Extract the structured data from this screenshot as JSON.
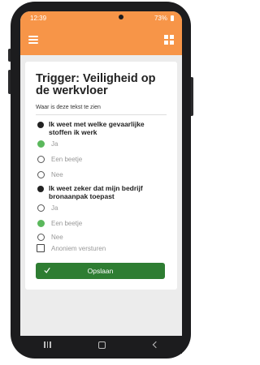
{
  "status": {
    "time": "12:39",
    "battery": "73%"
  },
  "icons": {
    "menu": "hamburger-icon",
    "dashboard": "grid-icon",
    "save": "checkmark-icon"
  },
  "colors": {
    "accent": "#f79548",
    "selected": "#5bb85c",
    "save_button": "#2e7d32"
  },
  "page": {
    "title": "Trigger: Veiligheid op de werkvloer",
    "link_text": "Waar is deze tekst te zien"
  },
  "questions": [
    {
      "text": "Ik weet met welke gevaarlijke stoffen ik werk",
      "options": [
        {
          "label": "Ja",
          "selected": true
        },
        {
          "label": "Een beetje",
          "selected": false
        },
        {
          "label": "Nee",
          "selected": false
        }
      ]
    },
    {
      "text": "Ik weet zeker dat mijn bedrijf bronaanpak toepast",
      "options": [
        {
          "label": "Ja",
          "selected": false
        },
        {
          "label": "Een beetje",
          "selected": true
        },
        {
          "label": "Nee",
          "selected": false
        }
      ]
    }
  ],
  "anonymous": {
    "label": "Anoniem versturen",
    "checked": false
  },
  "save_label": "Opslaan"
}
